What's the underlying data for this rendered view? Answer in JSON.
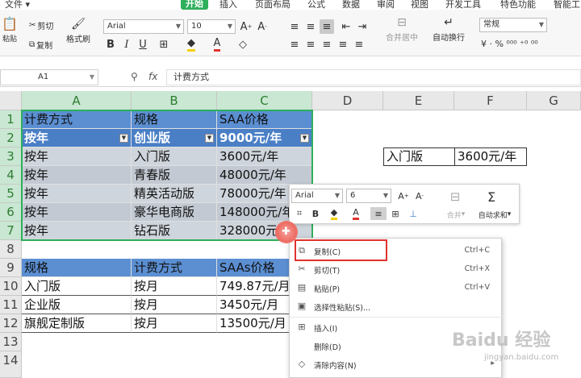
{
  "ribbon_tabs": [
    "文件",
    "开始",
    "插入",
    "页面布局",
    "公式",
    "数据",
    "审阅",
    "视图",
    "开发工具",
    "特色功能",
    "智能工"
  ],
  "active_tab": "开始",
  "ribbon": {
    "paste": "粘贴",
    "cut": "剪切",
    "copy": "复制",
    "format_painter": "格式刷",
    "font_name": "Arial",
    "font_size": "10",
    "merge_center": "合并居中",
    "wrap_text": "自动换行",
    "number_format": "常规"
  },
  "formula_bar": {
    "name_box": "A1",
    "fx_label": "fx",
    "formula": "计费方式"
  },
  "columns": [
    "A",
    "B",
    "C",
    "D",
    "E",
    "F",
    "G"
  ],
  "rows": [
    "1",
    "2",
    "3",
    "4",
    "5",
    "6",
    "7",
    "8",
    "9",
    "10",
    "11",
    "12",
    "13",
    "14"
  ],
  "table1": {
    "header": [
      "计费方式",
      "规格",
      "SAA价格"
    ],
    "filter_row": [
      "按年",
      "创业版",
      "9000元/年"
    ],
    "rows": [
      [
        "按年",
        "入门版",
        "3600元/年"
      ],
      [
        "按年",
        "青春版",
        "48000元/年"
      ],
      [
        "按年",
        "精英活动版",
        "78000元/年"
      ],
      [
        "按年",
        "豪华电商版",
        "148000元/年"
      ],
      [
        "按年",
        "钻石版",
        "328000元/年"
      ]
    ]
  },
  "lookup": {
    "label": "入门版",
    "value": "3600元/年"
  },
  "table2": {
    "header": [
      "规格",
      "计费方式",
      "SAAs价格"
    ],
    "rows": [
      [
        "入门版",
        "按月",
        "749.87元/月"
      ],
      [
        "企业版",
        "按月",
        "3450元/月"
      ],
      [
        "旗舰定制版",
        "按月",
        "13500元/月"
      ]
    ]
  },
  "mini_toolbar": {
    "font_name": "Arial",
    "font_size": "6",
    "merge": "合并",
    "autosum": "自动求和"
  },
  "context_menu": [
    {
      "label": "复制(C)",
      "shortcut": "Ctrl+C",
      "icon": "copy-icon"
    },
    {
      "label": "剪切(T)",
      "shortcut": "Ctrl+X",
      "icon": "cut-icon"
    },
    {
      "label": "粘贴(P)",
      "shortcut": "Ctrl+V",
      "icon": "paste-icon"
    },
    {
      "label": "选择性粘贴(S)...",
      "shortcut": "",
      "icon": "paste-special-icon"
    },
    {
      "label": "插入(I)",
      "shortcut": "",
      "icon": "insert-icon"
    },
    {
      "label": "删除(D)",
      "shortcut": "",
      "icon": ""
    },
    {
      "label": "清除内容(N)",
      "shortcut": "",
      "icon": "eraser-icon"
    }
  ],
  "watermark": {
    "line1": "Baidu 经验",
    "line2": "jingyan.baidu.com"
  },
  "colors": {
    "accent": "#2eaf5b",
    "header_blue": "#5b8fd2",
    "highlight_red": "#e0322e"
  }
}
